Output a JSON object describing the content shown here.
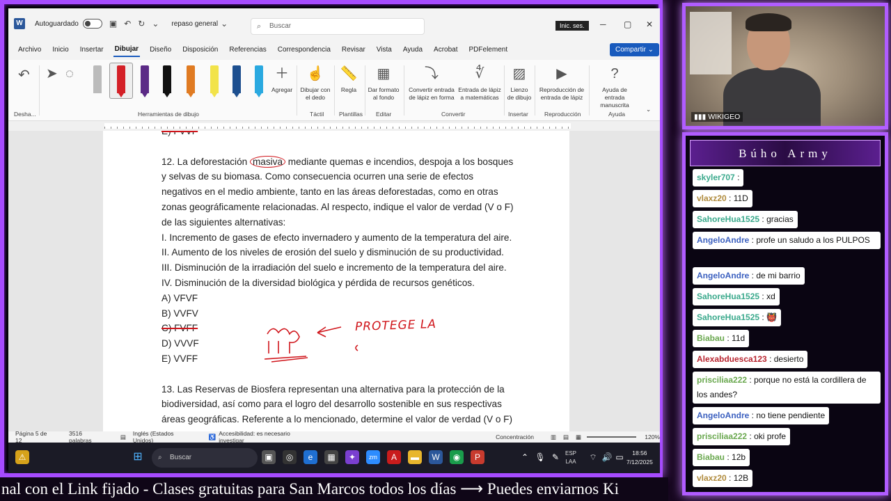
{
  "word": {
    "autosave_label": "Autoguardado",
    "doc_name": "repaso general",
    "search_placeholder": "Buscar",
    "signin_label": "Inic. ses.",
    "share_label": "Compartir",
    "menu_tabs": [
      "Archivo",
      "Inicio",
      "Insertar",
      "Dibujar",
      "Diseño",
      "Disposición",
      "Referencias",
      "Correspondencia",
      "Revisar",
      "Vista",
      "Ayuda",
      "Acrobat",
      "PDFelement"
    ],
    "active_tab": "Dibujar",
    "ribbon": {
      "undo_group": "Desha...",
      "add_label": "Agregar",
      "draw_finger": [
        "Dibujar con",
        "el dedo"
      ],
      "ruler": "Regla",
      "format_bg": [
        "Dar formato",
        "al fondo"
      ],
      "convert_shape": [
        "Convertir entrada",
        "de lápiz en forma"
      ],
      "math_input": [
        "Entrada de lápiz",
        "a matemáticas"
      ],
      "canvas": [
        "Lienzo",
        "de dibujo"
      ],
      "replay": [
        "Reproducción de",
        "entrada de lápiz"
      ],
      "ink_help": [
        "Ayuda de entrada",
        "manuscrita"
      ],
      "groups": [
        "Herramientas de dibujo",
        "Táctil",
        "Plantillas",
        "Editar",
        "Convertir",
        "Insertar",
        "Reproducción",
        "Ayuda"
      ]
    },
    "document": {
      "prev_answer": "E) FVVF",
      "q12_lines": [
        "12. La deforestación masiva mediante quemas e incendios, despoja a los bosques",
        "y selvas de su biomasa. Como consecuencia ocurren una serie de efectos",
        "negativos en el medio ambiente, tanto en las áreas deforestadas, como en otras",
        "zonas geográficamente relacionadas. Al respecto, indique el valor de verdad (V o F)",
        "de las siguientes alternativas:",
        "I. Incremento de gases de efecto invernadero y aumento de la temperatura del aire.",
        "II. Aumento de los niveles de erosión del suelo y disminución de su productividad.",
        "III. Disminución de la irradiación del suelo e incremento de la temperatura del aire.",
        "IV. Disminución de la diversidad biológica y pérdida de recursos genéticos."
      ],
      "q12_options": [
        "A) VFVF",
        "B) VVFV",
        "C) FVFF",
        "D) VVVF",
        "E) VVFF"
      ],
      "q13_lines": [
        "13. Las Reservas de Biosfera representan una alternativa para la protección de la",
        "biodiversidad, así como para el logro del desarrollo sostenible en sus respectivas",
        "áreas geográficas. Referente a lo mencionado, determine el valor de verdad (V o F)"
      ],
      "handwriting": "PROTEGE LA"
    },
    "status": {
      "page": "Página 5 de 12",
      "words": "3516 palabras",
      "language": "Inglés (Estados Unidos)",
      "accessibility": "Accesibilidad: es necesario investigar",
      "focus": "Concentración",
      "zoom": "120%"
    }
  },
  "taskbar": {
    "search_placeholder": "Buscar",
    "lang": [
      "ESP",
      "LAA"
    ],
    "time": "18:56",
    "date": "7/12/2025"
  },
  "ticker": "nal con el Link fijado  -  Clases gratuitas para San Marcos todos los días  ⟶  Puedes enviarnos Ki",
  "webcam": {
    "label": "WIKIGEO"
  },
  "chat": {
    "title": "Búho Army",
    "messages": [
      {
        "user": "skyler707",
        "text": "",
        "color": "teal"
      },
      {
        "user": "vlaxz20",
        "text": "11D",
        "color": "tan"
      },
      {
        "user": "SahoreHua1525",
        "text": "gracias",
        "color": "teal"
      },
      {
        "user": "AngeloAndre",
        "text": "profe un saludo a los PULPOS",
        "color": "blue"
      },
      {
        "user": "AngeloAndre",
        "text": "de mi barrio",
        "color": "blue"
      },
      {
        "user": "SahoreHua1525",
        "text": "xd",
        "color": "teal"
      },
      {
        "user": "SahoreHua1525",
        "text": "👹",
        "color": "teal"
      },
      {
        "user": "Biabau",
        "text": "11d",
        "color": "green"
      },
      {
        "user": "Alexabduesca123",
        "text": "desierto",
        "color": "red"
      },
      {
        "user": "prisciliaa222",
        "text": "porque no está la cordillera de los andes?",
        "color": "green"
      },
      {
        "user": "AngeloAndre",
        "text": "no tiene pendiente",
        "color": "blue"
      },
      {
        "user": "prisciliaa222",
        "text": "oki profe",
        "color": "green"
      },
      {
        "user": "Biabau",
        "text": "12b",
        "color": "green"
      },
      {
        "user": "vlaxz20",
        "text": "12B",
        "color": "tan"
      }
    ]
  }
}
